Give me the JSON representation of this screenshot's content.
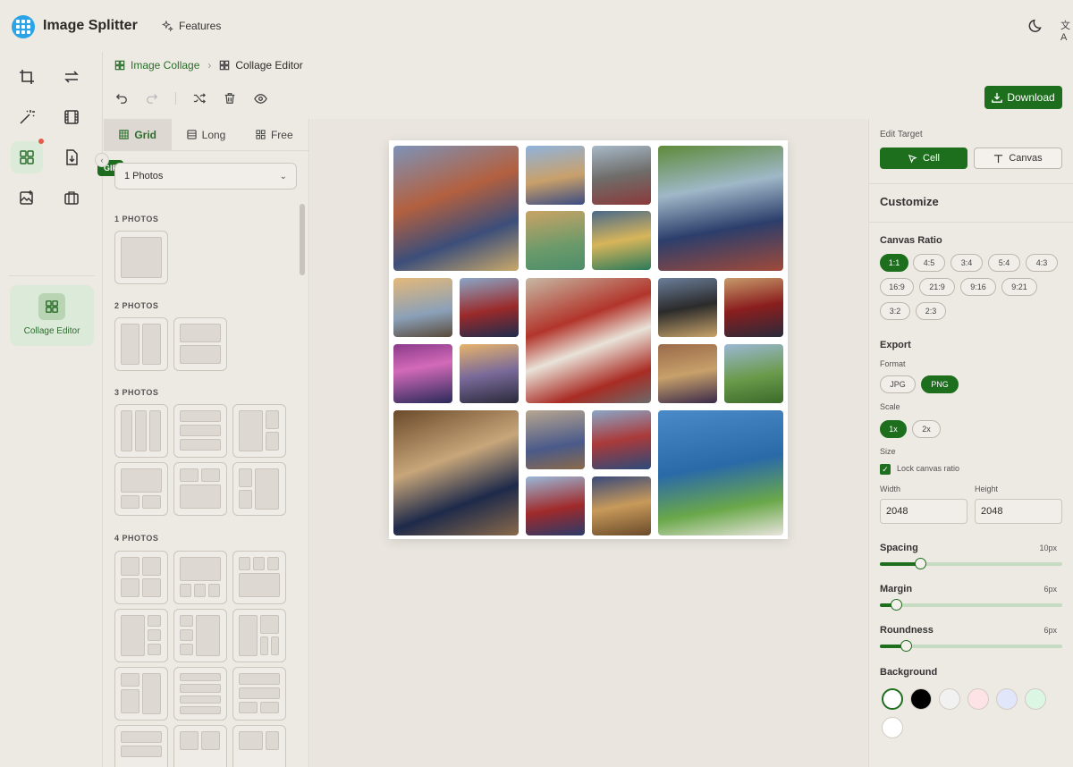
{
  "header": {
    "app_title": "Image Splitter",
    "features_label": "Features"
  },
  "rail": {
    "gif_label": "GIF",
    "collage_editor_label": "Collage Editor"
  },
  "breadcrumb": {
    "root": "Image Collage",
    "current": "Collage Editor"
  },
  "toolbar": {
    "download_label": "Download"
  },
  "layout_panel": {
    "tabs": [
      {
        "label": "Grid"
      },
      {
        "label": "Long"
      },
      {
        "label": "Free"
      }
    ],
    "photo_count_select": "1 Photos",
    "sections": [
      {
        "title": "1 PHOTOS"
      },
      {
        "title": "2 PHOTOS"
      },
      {
        "title": "3 PHOTOS"
      },
      {
        "title": "4 PHOTOS"
      }
    ]
  },
  "right_panel": {
    "edit_target_label": "Edit Target",
    "cell_label": "Cell",
    "canvas_label": "Canvas",
    "customize_title": "Customize",
    "canvas_ratio_label": "Canvas Ratio",
    "ratios": [
      "1:1",
      "4:5",
      "3:4",
      "5:4",
      "4:3",
      "16:9",
      "21:9",
      "9:16",
      "9:21",
      "3:2",
      "2:3"
    ],
    "selected_ratio": "1:1",
    "export_label": "Export",
    "format_label": "Format",
    "formats": [
      "JPG",
      "PNG"
    ],
    "scale_label": "Scale",
    "scales": [
      "1x",
      "2x"
    ],
    "size_label": "Size",
    "lock_ratio_label": "Lock canvas ratio",
    "width_label": "Width",
    "height_label": "Height",
    "width_value": "2048",
    "height_value": "2048",
    "spacing_label": "Spacing",
    "spacing_value": "10px",
    "spacing_level": 0.22,
    "margin_label": "Margin",
    "margin_value": "6px",
    "margin_level": 0.09,
    "roundness_label": "Roundness",
    "roundness_value": "6px",
    "roundness_level": 0.14,
    "background_label": "Background",
    "background_colors": [
      "#ffffff",
      "#000000",
      "#f1f1f1",
      "#fde3e6",
      "#e2e6fb",
      "#dcf6e4",
      "#ffffff"
    ]
  },
  "colors": {
    "accent": "#1d6e1d",
    "accent_light": "#dcead9",
    "surface": "#ede9e3"
  }
}
